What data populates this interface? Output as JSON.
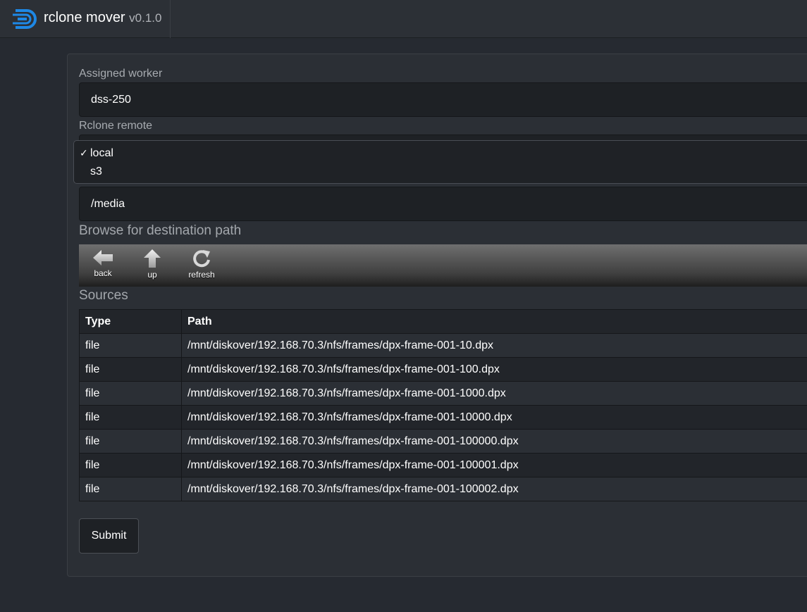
{
  "app": {
    "name": "rclone mover",
    "version": "v0.1.0"
  },
  "form": {
    "worker_label": "Assigned worker",
    "worker_value": "dss-250",
    "remote_label": "Rclone remote",
    "remote_options": [
      {
        "label": "local",
        "selected": true
      },
      {
        "label": "s3",
        "selected": false
      }
    ],
    "path_value": "/media",
    "browse_title": "Browse for destination path",
    "submit_label": "Submit"
  },
  "toolbar": {
    "back_label": "back",
    "up_label": "up",
    "refresh_label": "refresh"
  },
  "sources": {
    "title": "Sources",
    "headers": [
      "Type",
      "Path"
    ],
    "rows": [
      {
        "type": "file",
        "path": "/mnt/diskover/192.168.70.3/nfs/frames/dpx-frame-001-10.dpx"
      },
      {
        "type": "file",
        "path": "/mnt/diskover/192.168.70.3/nfs/frames/dpx-frame-001-100.dpx"
      },
      {
        "type": "file",
        "path": "/mnt/diskover/192.168.70.3/nfs/frames/dpx-frame-001-1000.dpx"
      },
      {
        "type": "file",
        "path": "/mnt/diskover/192.168.70.3/nfs/frames/dpx-frame-001-10000.dpx"
      },
      {
        "type": "file",
        "path": "/mnt/diskover/192.168.70.3/nfs/frames/dpx-frame-001-100000.dpx"
      },
      {
        "type": "file",
        "path": "/mnt/diskover/192.168.70.3/nfs/frames/dpx-frame-001-100001.dpx"
      },
      {
        "type": "file",
        "path": "/mnt/diskover/192.168.70.3/nfs/frames/dpx-frame-001-100002.dpx"
      }
    ]
  },
  "colors": {
    "logo_blue": "#1e88e5",
    "background": "#262a31",
    "field_bg": "#1e2125"
  }
}
